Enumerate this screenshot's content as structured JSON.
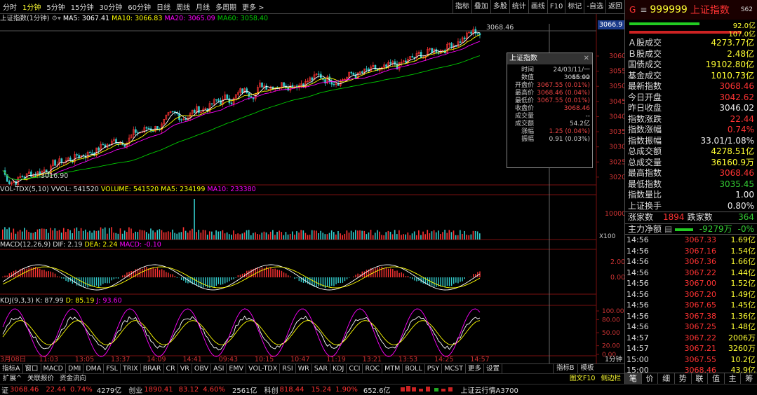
{
  "toolbar": {
    "timeframes": [
      "分时",
      "1分钟",
      "5分钟",
      "15分钟",
      "30分钟",
      "60分钟",
      "日线",
      "周线",
      "月线",
      "多周期",
      "更多 >"
    ],
    "active_timeframe": "1分钟",
    "tools": [
      "指标",
      "叠加",
      "多股",
      "统计",
      "画线",
      "F10",
      "标记",
      "-自选",
      "返回"
    ]
  },
  "main_legend": {
    "name": "上证指数(1分钟)",
    "ma5": "MA5: 3067.41",
    "ma10": "MA10: 3066.83",
    "ma20": "MA20: 3065.09",
    "ma60": "MA60: 3058.40"
  },
  "price_labels": {
    "high": "3068.46",
    "low": "3016.90",
    "current_box": "3066.9"
  },
  "yaxis_main": [
    "3060",
    "3055",
    "3050",
    "3045",
    "3040",
    "3035",
    "3030",
    "3025",
    "3020"
  ],
  "vol_legend": {
    "name": "VOL-TDX(5,10)",
    "vvol": "VVOL: 541520",
    "volume": "VOLUME: 541520",
    "ma5": "MA5: 234199",
    "ma10": "MA10: 233380"
  },
  "yaxis_vol": [
    "10000",
    "X100"
  ],
  "macd_legend": {
    "name": "MACD(12,26,9)",
    "dif": "DIF: 2.19",
    "dea": "DEA: 2.24",
    "macd": "MACD: -0.10"
  },
  "yaxis_macd": [
    "2.00",
    "0.00"
  ],
  "kdj_legend": {
    "name": "KDJ(9,3,3)",
    "k": "K: 87.99",
    "d": "D: 85.19",
    "j": "J: 93.60"
  },
  "yaxis_kdj": [
    "100.00",
    "80.00",
    "50.00",
    "20.00",
    "0.00"
  ],
  "time_axis": [
    "3月08日",
    "11:03",
    "13:05",
    "13:37",
    "14:09",
    "14:41",
    "09:43",
    "10:15",
    "10:47",
    "11:19",
    "13:21",
    "13:53",
    "14:25",
    "14:57"
  ],
  "time_axis_right": "1分钟",
  "bottom_tabs": [
    "指标A",
    "窗口",
    "MACD",
    "DMI",
    "DMA",
    "FSL",
    "TRIX",
    "BRAR",
    "CR",
    "VR",
    "OBV",
    "ASI",
    "EMV",
    "VOL-TDX",
    "RSI",
    "WR",
    "SAR",
    "KDJ",
    "CCI",
    "ROC",
    "MTM",
    "BOLL",
    "PSY",
    "MCST",
    "更多",
    "设置"
  ],
  "bottom_right_tabs": [
    "指标B",
    "模板"
  ],
  "status_links": [
    "扩展^",
    "关联报价",
    "资金流向"
  ],
  "status_right": [
    "图文F10",
    "侧边栏"
  ],
  "infobox": {
    "title": "上证指数",
    "rows": [
      {
        "k": "时间",
        "v": "24/03/11/一 15:00",
        "c": ""
      },
      {
        "k": "数值",
        "v": "3066.92",
        "c": ""
      },
      {
        "k": "开盘价",
        "v": "3067.55 (0.01%)",
        "c": "red"
      },
      {
        "k": "最高价",
        "v": "3068.46 (0.04%)",
        "c": "red"
      },
      {
        "k": "最低价",
        "v": "3067.55 (0.01%)",
        "c": "red"
      },
      {
        "k": "收盘价",
        "v": "3068.46",
        "c": "red"
      },
      {
        "k": "成交量",
        "v": "--",
        "c": ""
      },
      {
        "k": "成交额",
        "v": "54.2亿",
        "c": ""
      },
      {
        "k": "涨幅",
        "v": "1.25 (0.04%)",
        "c": "red"
      },
      {
        "k": "振幅",
        "v": "0.91 (0.03%)",
        "c": ""
      }
    ]
  },
  "right_panel": {
    "code": "999999",
    "name": "上证指数",
    "badge": "S62",
    "bar_vals": [
      "92.0亿",
      "107.0亿"
    ],
    "stats": [
      {
        "k": "Ａ股成交",
        "v": "4273.77亿",
        "c": "yel"
      },
      {
        "k": "Ｂ股成交",
        "v": "2.48亿",
        "c": "yel"
      },
      {
        "k": "国债成交",
        "v": "19102.80亿",
        "c": "yel"
      },
      {
        "k": "基金成交",
        "v": "1010.73亿",
        "c": "yel"
      },
      {
        "k": "最新指数",
        "v": "3068.46",
        "c": "red"
      },
      {
        "k": "今日开盘",
        "v": "3042.62",
        "c": "red"
      },
      {
        "k": "昨日收盘",
        "v": "3046.02",
        "c": "wht"
      },
      {
        "k": "指数涨跌",
        "v": "22.44",
        "c": "red"
      },
      {
        "k": "指数涨幅",
        "v": "0.74%",
        "c": "red"
      },
      {
        "k": "指数振幅",
        "v": "33.01/1.08%",
        "c": "wht"
      },
      {
        "k": "总成交额",
        "v": "4278.51亿",
        "c": "yel"
      },
      {
        "k": "总成交量",
        "v": "36160.9万",
        "c": "yel"
      },
      {
        "k": "最高指数",
        "v": "3068.46",
        "c": "red"
      },
      {
        "k": "最低指数",
        "v": "3035.45",
        "c": "green"
      },
      {
        "k": "指数量比",
        "v": "1.00",
        "c": "wht"
      },
      {
        "k": "上证换手",
        "v": "0.80%",
        "c": "wht"
      }
    ],
    "updown": {
      "up_label": "涨家数",
      "up": "1894",
      "down_label": "跌家数",
      "down": "364"
    },
    "netflow": {
      "label": "主力净额",
      "value": "-9279万",
      "pct": "-0%"
    },
    "ticks": [
      {
        "t": "14:56",
        "p": "3067.33",
        "v": "1.69亿"
      },
      {
        "t": "14:56",
        "p": "3067.16",
        "v": "1.54亿"
      },
      {
        "t": "14:56",
        "p": "3067.36",
        "v": "1.66亿"
      },
      {
        "t": "14:56",
        "p": "3067.22",
        "v": "1.44亿"
      },
      {
        "t": "14:56",
        "p": "3067.00",
        "v": "1.52亿"
      },
      {
        "t": "14:56",
        "p": "3067.20",
        "v": "1.49亿"
      },
      {
        "t": "14:56",
        "p": "3067.65",
        "v": "1.45亿"
      },
      {
        "t": "14:56",
        "p": "3067.38",
        "v": "1.36亿"
      },
      {
        "t": "14:56",
        "p": "3067.25",
        "v": "1.48亿"
      },
      {
        "t": "14:57",
        "p": "3067.22",
        "v": "2006万"
      },
      {
        "t": "14:57",
        "p": "3067.21",
        "v": "3260万"
      },
      {
        "t": "15:00",
        "p": "3067.55",
        "v": "10.2亿"
      },
      {
        "t": "15:00",
        "p": "3068.46",
        "v": "43.9亿"
      }
    ],
    "tabs": [
      "笔",
      "价",
      "细",
      "势",
      "联",
      "值",
      "主",
      "筹"
    ]
  },
  "ticker": {
    "sh_label": "证",
    "sh_val": "3068.46",
    "sh_chg": "22.44",
    "sh_pct": "0.74%",
    "sh_amt": "4279亿",
    "cy_label": "创业",
    "cy_val": "1890.41",
    "cy_chg": "83.12",
    "cy_pct": "4.60%",
    "cy_amt": "2561亿",
    "kc_label": "科创",
    "kc_val": "818.44",
    "kc_chg": "15.24",
    "kc_pct": "1.90%",
    "kc_amt": "652.6亿",
    "news": "上证云行情A3700"
  },
  "colors": {
    "ma5": "#ffffff",
    "ma10": "#ffff00",
    "ma20": "#ff00ff",
    "ma60": "#00cc00",
    "up": "#ff3333",
    "down": "#33cccc"
  }
}
